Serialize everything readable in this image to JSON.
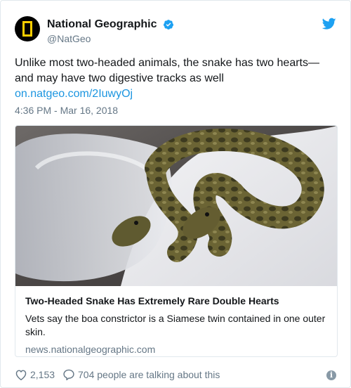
{
  "tweet": {
    "display_name": "National Geographic",
    "handle": "@NatGeo",
    "text": "Unlike most two-headed animals, the snake has two hearts—and may have two digestive tracks as well",
    "link": "on.natgeo.com/2IuwyOj",
    "timestamp": "4:36 PM - Mar 16, 2018"
  },
  "card": {
    "title": "Two-Headed Snake Has Extremely Rare Double Hearts",
    "description": "Vets say the boa constrictor is a Siamese twin contained in one outer skin.",
    "domain": "news.nationalgeographic.com"
  },
  "actions": {
    "likes": "2,153",
    "talking": "704 people are talking about this"
  },
  "icons": {
    "avatar": "natgeo-logo",
    "verified": "verified-badge",
    "twitter": "twitter-bird-icon",
    "like": "heart-icon",
    "reply": "comment-icon",
    "info": "info-icon"
  },
  "colors": {
    "link": "#1b95e0",
    "verified": "#1da1f2",
    "muted": "#657786",
    "logo_yellow": "#ffce00"
  }
}
